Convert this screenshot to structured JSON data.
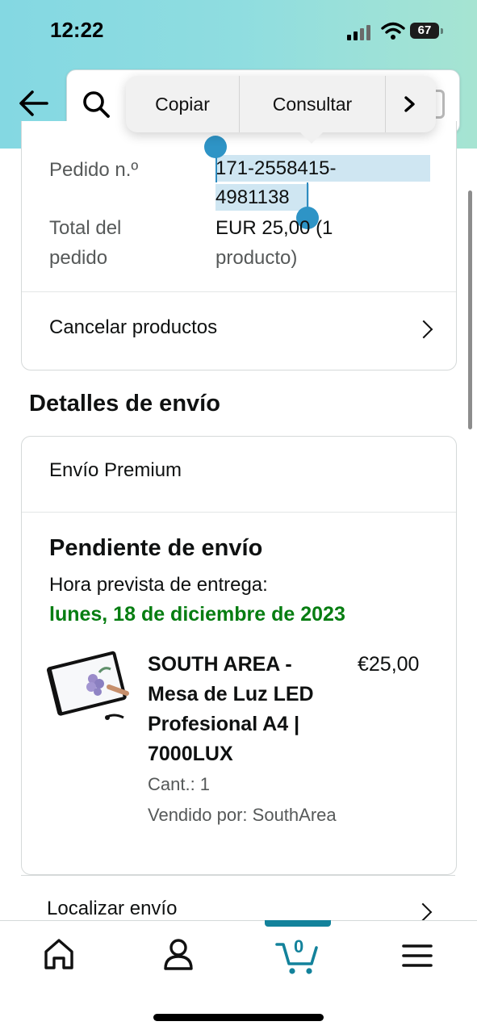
{
  "status_bar": {
    "time": "12:22",
    "battery": "67"
  },
  "context_menu": {
    "items": [
      "Copiar",
      "Consultar"
    ]
  },
  "order": {
    "order_label": "Pedido n.º",
    "order_number_line1": "171-2558415-",
    "order_number_line2": "4981138",
    "total_label_line1": "Total del",
    "total_label_line2": "pedido",
    "total_value_line1": "EUR 25,00 (1",
    "total_value_line2": "producto)",
    "cancel_label": "Cancelar productos"
  },
  "shipping": {
    "section_title": "Detalles de envío",
    "method": "Envío Premium",
    "status": "Pendiente de envío",
    "eta_label": "Hora prevista de entrega:",
    "eta_date": "lunes, 18 de diciembre de 2023",
    "product": {
      "title_lines": [
        "SOUTH AREA -",
        "Mesa de Luz LED",
        "Profesional A4 |",
        "7000LUX"
      ],
      "price": "€25,00",
      "quantity": "Cant.: 1",
      "seller": "Vendido por: SouthArea"
    },
    "track_label": "Localizar envío"
  },
  "tab_bar": {
    "cart_count": "0",
    "active_tab": "cart"
  },
  "colors": {
    "accent": "#13829b",
    "green": "#067d11",
    "selection": "#cfe6f2",
    "handle": "#2e94c6"
  }
}
